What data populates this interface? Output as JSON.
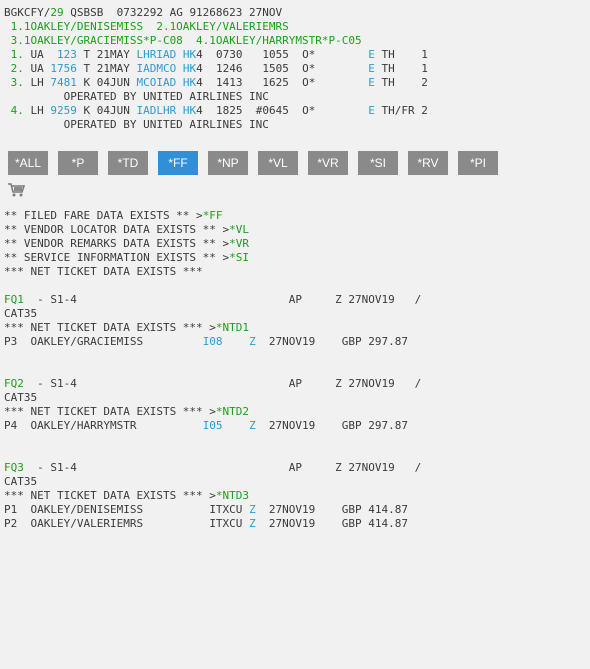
{
  "header": {
    "record_line": {
      "prefix": "BGKCFY/",
      "agent": "29",
      "rest": " QSBSB  0732292 AG 91268623 27NOV"
    },
    "names_line1": " 1.1OAKLEY/DENISEMISS  2.1OAKLEY/VALERIEMRS",
    "names_line2": " 3.1OAKLEY/GRACIEMISS*P-C08  4.1OAKLEY/HARRYMSTR*P-C05"
  },
  "segments": [
    {
      "num": " 1.",
      "air": " UA ",
      "flt": " 123",
      "cls": " T",
      "date": " 21MAY ",
      "route": "LHRIAD",
      "st": " HK",
      "rest": "4  0730   1055  O*        ",
      "e": "E",
      "tail": " TH    1"
    },
    {
      "num": " 2.",
      "air": " UA ",
      "flt": "1756",
      "cls": " T",
      "date": " 21MAY ",
      "route": "IADMCO",
      "st": " HK",
      "rest": "4  1246   1505  O*        ",
      "e": "E",
      "tail": " TH    1"
    },
    {
      "num": " 3.",
      "air": " LH ",
      "flt": "7481",
      "cls": " K",
      "date": " 04JUN ",
      "route": "MCOIAD",
      "st": " HK",
      "rest": "4  1413   1625  O*        ",
      "e": "E",
      "tail": " TH    2"
    },
    {
      "num": " 4.",
      "air": " LH ",
      "flt": "9259",
      "cls": " K",
      "date": " 04JUN ",
      "route": "IADLHR",
      "st": " HK",
      "rest": "4  1825  #0645  O*        ",
      "e": "E",
      "tail": " TH/FR 2"
    }
  ],
  "operated_by": "         OPERATED BY UNITED AIRLINES INC",
  "toolbar": {
    "buttons": [
      "*ALL",
      "*P",
      "*TD",
      "*FF",
      "*NP",
      "*VL",
      "*VR",
      "*SI",
      "*RV",
      "*PI"
    ],
    "active": "*FF"
  },
  "cart_icon": "shopping-cart-icon",
  "messages": [
    {
      "text": "** FILED FARE DATA EXISTS ** >",
      "link": "*FF"
    },
    {
      "text": "** VENDOR LOCATOR DATA EXISTS ** >",
      "link": "*VL"
    },
    {
      "text": "** VENDOR REMARKS DATA EXISTS ** >",
      "link": "*VR"
    },
    {
      "text": "** SERVICE INFORMATION EXISTS ** >",
      "link": "*SI"
    },
    {
      "text": "*** NET TICKET DATA EXISTS ***",
      "link": ""
    }
  ],
  "fares": [
    {
      "id": "FQ1",
      "seg": "  - S1-4                                AP     Z 27NOV19   /",
      "cat": "CAT35",
      "net_text": "*** NET TICKET DATA EXISTS *** >",
      "net_link": "*NTD1",
      "pax": [
        {
          "p": "P3  OAKLEY/GRACIEMISS         ",
          "code": "I08",
          "gap": "    ",
          "z": "Z",
          "tail": "  27NOV19    GBP 297.87",
          "code_blue": true
        }
      ]
    },
    {
      "id": "FQ2",
      "seg": "  - S1-4                                AP     Z 27NOV19   /",
      "cat": "CAT35",
      "net_text": "*** NET TICKET DATA EXISTS *** >",
      "net_link": "*NTD2",
      "pax": [
        {
          "p": "P4  OAKLEY/HARRYMSTR          ",
          "code": "I05",
          "gap": "    ",
          "z": "Z",
          "tail": "  27NOV19    GBP 297.87",
          "code_blue": true
        }
      ]
    },
    {
      "id": "FQ3",
      "seg": "  - S1-4                                AP     Z 27NOV19   /",
      "cat": "CAT35",
      "net_text": "*** NET TICKET DATA EXISTS *** >",
      "net_link": "*NTD3",
      "pax": [
        {
          "p": "P1  OAKLEY/DENISEMISS          ",
          "code": "ITXCU",
          "gap": " ",
          "z": "Z",
          "tail": "  27NOV19    GBP 414.87",
          "code_blue": false
        },
        {
          "p": "P2  OAKLEY/VALERIEMRS          ",
          "code": "ITXCU",
          "gap": " ",
          "z": "Z",
          "tail": "  27NOV19    GBP 414.87",
          "code_blue": false
        }
      ]
    }
  ],
  "colors": {
    "background": "#f1f1f1",
    "text": "#3a3a3a",
    "green": "#1aa01a",
    "blue": "#2e9ad0",
    "button": "#8a8a8a",
    "button_active": "#2f8fd8"
  }
}
